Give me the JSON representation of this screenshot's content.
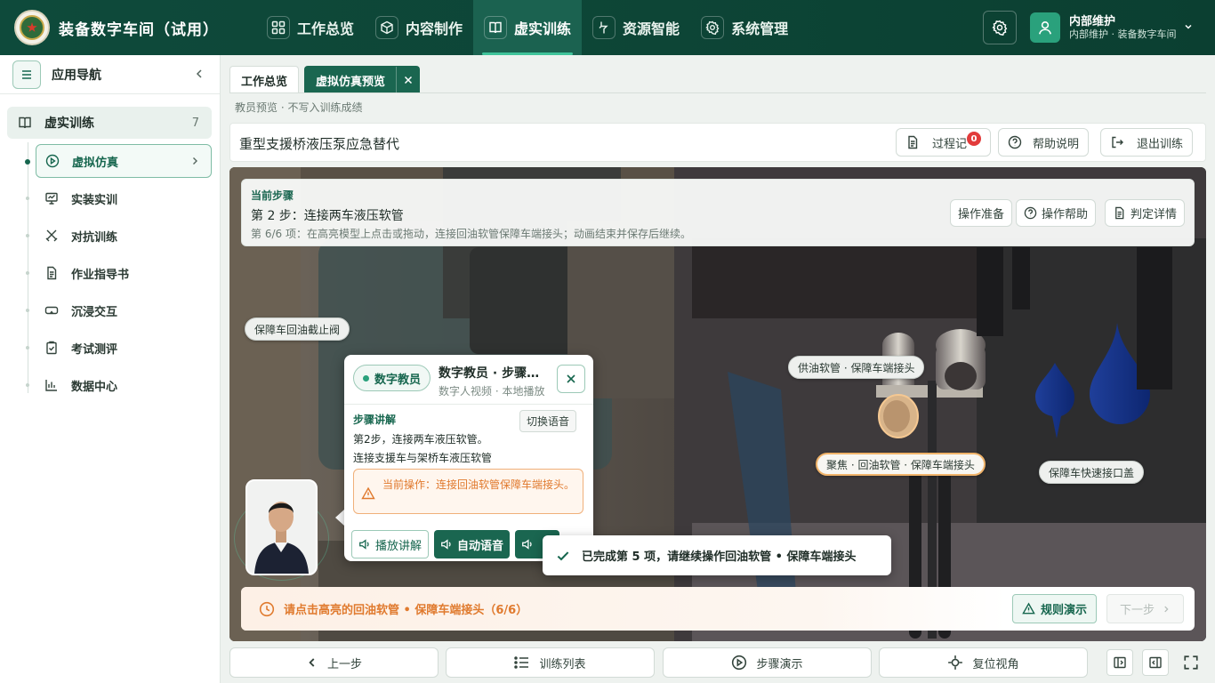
{
  "app": {
    "title": "装备数字车间（试用）"
  },
  "nav": [
    {
      "label": "工作总览",
      "icon": "grid-icon"
    },
    {
      "label": "内容制作",
      "icon": "cube-icon"
    },
    {
      "label": "虚实训练",
      "icon": "book-icon",
      "active": true
    },
    {
      "label": "资源智能",
      "icon": "bolt-icon"
    },
    {
      "label": "系统管理",
      "icon": "gear-icon"
    }
  ],
  "user": {
    "name": "内部维护",
    "sub": "内部维护 · 装备数字车间"
  },
  "sidebar": {
    "title": "应用导航",
    "group": {
      "label": "虚实训练",
      "count": "7"
    },
    "items": [
      {
        "label": "虚拟仿真",
        "icon": "play-circle-icon",
        "active": true
      },
      {
        "label": "实装实训",
        "icon": "monitor-icon"
      },
      {
        "label": "对抗训练",
        "icon": "crossed-swords-icon"
      },
      {
        "label": "作业指导书",
        "icon": "document-icon"
      },
      {
        "label": "沉浸交互",
        "icon": "vr-headset-icon"
      },
      {
        "label": "考试测评",
        "icon": "clipboard-check-icon"
      },
      {
        "label": "数据中心",
        "icon": "bar-chart-icon"
      }
    ]
  },
  "tabs": [
    {
      "label": "工作总览"
    },
    {
      "label": "虚拟仿真预览",
      "active": true
    }
  ],
  "hint": "教员预览 · 不写入训练成绩",
  "page": {
    "title": "重型支援桥液压泵应急替代",
    "process_label": "过程记",
    "process_badge": "0",
    "help_label": "帮助说明",
    "exit_label": "退出训练"
  },
  "step": {
    "label": "当前步骤",
    "title": "第 2 步：连接两车液压软管",
    "desc": "第 6/6 项：在高亮模型上点击或拖动，连接回油软管保障车端接头；动画结束并保存后继续。",
    "buttons": {
      "prep": "操作准备",
      "help": "操作帮助",
      "detail": "判定详情"
    }
  },
  "scene_labels": {
    "valve": "保障车回油截止阀",
    "supply": "供油软管 · 保障车端接头",
    "focus": "聚焦 · 回油软管 · 保障车端接头",
    "cap": "保障车快速接口盖"
  },
  "tutor": {
    "pill": "数字教员",
    "title": "数字教员 · 步骤讲解",
    "sub": "数字人视频 · 本地播放",
    "section": "步骤讲解",
    "switch_label": "切换语音",
    "line1": "第2步，连接两车液压软管。",
    "line2": "连接支援车与架桥车液压软管",
    "warn": "当前操作：连接回油软管保障车端接头。",
    "play_label": "播放讲解",
    "auto_label": "自动语音"
  },
  "toast": "已完成第 5 项，请继续操作回油软管 • 保障车端接头",
  "bottom": {
    "text": "请点击高亮的回油软管 • 保障车端接头（6/6）",
    "rule_label": "规则演示",
    "next_label": "下一步"
  },
  "footer": {
    "prev": "上一步",
    "list": "训练列表",
    "demo": "步骤演示",
    "reset": "复位视角"
  }
}
